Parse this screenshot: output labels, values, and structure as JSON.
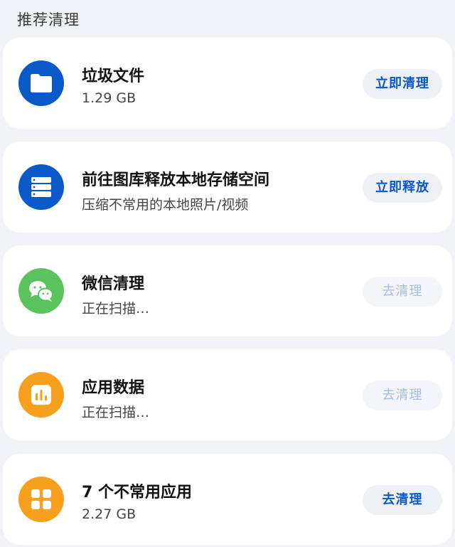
{
  "section_title": "推荐清理",
  "colors": {
    "blue": "#0a59c8",
    "green": "#5bc35e",
    "orange": "#f7a01d"
  },
  "items": [
    {
      "icon": "folder-icon",
      "title": "垃圾文件",
      "subtitle": "1.29 GB",
      "action": "立即清理",
      "action_enabled": true
    },
    {
      "icon": "storage-icon",
      "title": "前往图库释放本地存储空间",
      "subtitle": "压缩不常用的本地照片/视频",
      "action": "立即释放",
      "action_enabled": true
    },
    {
      "icon": "wechat-icon",
      "title": "微信清理",
      "subtitle": "正在扫描…",
      "action": "去清理",
      "action_enabled": false
    },
    {
      "icon": "app-data-icon",
      "title": "应用数据",
      "subtitle": "正在扫描…",
      "action": "去清理",
      "action_enabled": false
    },
    {
      "icon": "apps-grid-icon",
      "title": "7 个不常用应用",
      "subtitle": "2.27 GB",
      "action": "去清理",
      "action_enabled": true
    }
  ]
}
